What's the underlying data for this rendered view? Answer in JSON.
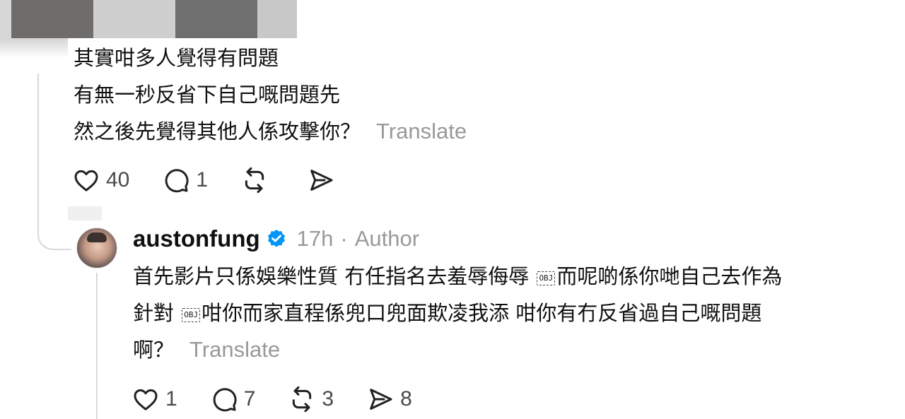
{
  "comment": {
    "lines": [
      "其實咁多人覺得有問題",
      "有無一秒反省下自己嘅問題先",
      "然之後先覺得其他人係攻擊你？"
    ],
    "translate_label": "Translate",
    "actions": {
      "likes": "40",
      "replies": "1",
      "reposts": "",
      "shares": ""
    }
  },
  "reply": {
    "username": "austonfung",
    "time": "17h",
    "separator": "·",
    "author_label": "Author",
    "segments": {
      "line1_a": "首先影片只係娛樂性質 冇任指名去羞辱侮辱 ",
      "obj_marker": "OBJ",
      "line1_b": "而呢啲係你哋自己去作為",
      "line2_a": "針對 ",
      "line2_b": "咁你而家直程係兜口兜面欺凌我添 咁你有冇反省過自己嘅問題",
      "line3": "啊？"
    },
    "translate_label": "Translate",
    "actions": {
      "likes": "1",
      "replies": "7",
      "reposts": "3",
      "shares": "8"
    }
  },
  "colors": {
    "text": "#101010",
    "muted": "#999999",
    "thread_line": "#d9d9d9",
    "verified": "#0095f6"
  },
  "icons": [
    "heart-icon",
    "comment-icon",
    "repost-icon",
    "share-icon",
    "verified-badge-icon"
  ]
}
